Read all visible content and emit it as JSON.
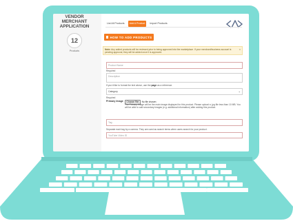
{
  "sidebar": {
    "title_lines": [
      "VENDOR",
      "MERCHANT",
      "APPLICATION"
    ],
    "product_count": "12",
    "product_label": "Products"
  },
  "tabs": [
    {
      "label": "List All Products",
      "active": false
    },
    {
      "label": "Add A Product",
      "active": true
    },
    {
      "label": "Import Products",
      "active": false
    }
  ],
  "add_button": {
    "label": "HOW TO ADD PRODUCTS",
    "icon": "document-icon"
  },
  "note": {
    "bold": "Note:",
    "text": " Any added products will be reviewed prior to being approved into the marketplace. If your merchant/business account is pending approval, they will be added once it is approved.",
    "close": "×"
  },
  "form": {
    "product_name_placeholder": "Product Name",
    "required_1": "Required",
    "description_placeholder": "Description",
    "format_help_prefix": "If you'd like to format the text above, use the ",
    "format_help_link": "page",
    "format_help_suffix": " as a reference.",
    "category_value": "Category",
    "required_2": "Required",
    "primary_image_label": "Primary Image",
    "choose_file_label": "Choose File",
    "no_file_text": "No file chosen",
    "primary_image_help": "The Primary Image will be the main image displayed for this product. Please upload a .jpg file less than 10 MB. You will be able to add secondary images (e.g. additional information) after adding this product.",
    "tag_placeholder": "Tag",
    "tag_help": "Separate each tag by a comma. They are used as search terms when users search for your product.",
    "youtube_placeholder": "YouTube Video ID"
  },
  "colors": {
    "laptop": "#7ddcd5",
    "keys": "#ffffff",
    "accent": "#f47a1f"
  }
}
